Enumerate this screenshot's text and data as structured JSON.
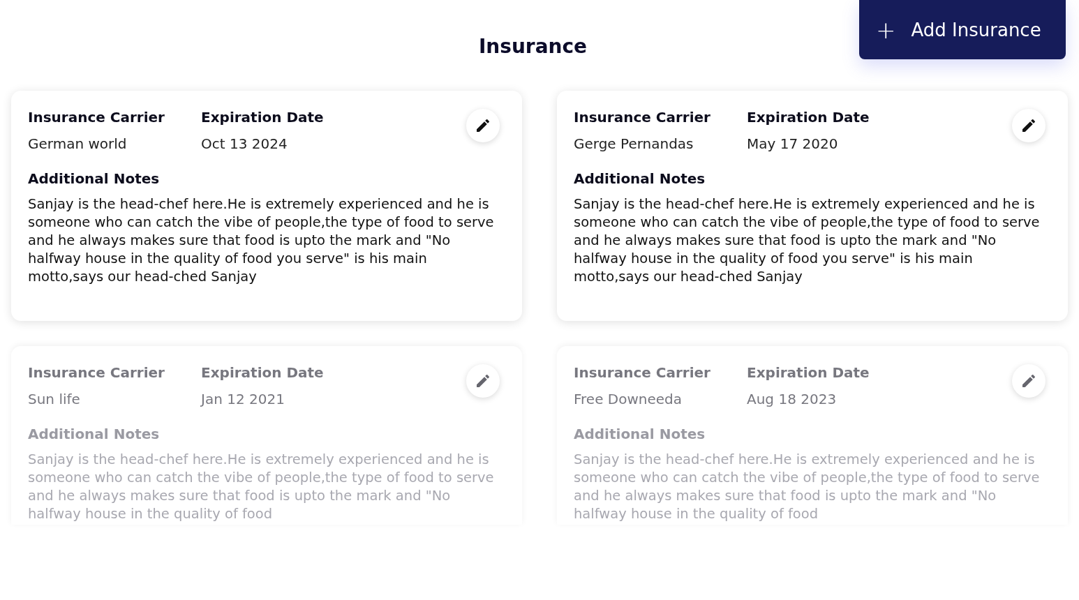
{
  "title": "Insurance",
  "add_button": {
    "icon": "+",
    "label": "Add Insurance"
  },
  "cards": [
    {
      "faded": false,
      "carrier_label": "Insurance Carrier",
      "carrier": "German world",
      "date_label": "Expiration Date",
      "date": "Oct 13 2024",
      "notes_label": "Additional Notes",
      "notes": "Sanjay is the head-chef here.He is extremely experienced and he is someone who can catch the vibe of people,the type of food to serve and he always makes sure that food is upto the mark and \"No halfway house in the quality of food you serve\" is his main motto,says our head-ched Sanjay"
    },
    {
      "faded": false,
      "carrier_label": "Insurance Carrier",
      "carrier": "Gerge Pernandas",
      "date_label": "Expiration Date",
      "date": "May 17 2020",
      "notes_label": "Additional Notes",
      "notes": "Sanjay is the head-chef here.He is extremely experienced and he is someone who can catch the vibe of people,the type of food to serve and he always makes sure that food is upto the mark and \"No halfway house in the quality of food you serve\" is his main motto,says our head-ched Sanjay"
    },
    {
      "faded": true,
      "carrier_label": "Insurance Carrier",
      "carrier": "Sun life",
      "date_label": "Expiration Date",
      "date": "Jan 12 2021",
      "notes_label": "Additional Notes",
      "notes": "Sanjay is the head-chef here.He is extremely experienced and he is someone who can catch the vibe of people,the type of food to serve and he always makes sure that food is upto the mark and \"No halfway house in the quality of food"
    },
    {
      "faded": true,
      "carrier_label": "Insurance Carrier",
      "carrier": "Free Downeeda",
      "date_label": "Expiration Date",
      "date": "Aug 18 2023",
      "notes_label": "Additional Notes",
      "notes": "Sanjay is the head-chef here.He is extremely experienced and he is someone who can catch the vibe of people,the type of food to serve and he always makes sure that food is upto the mark and \"No halfway house in the quality of food"
    }
  ]
}
